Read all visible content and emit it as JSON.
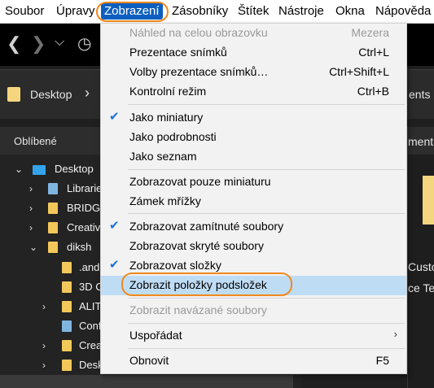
{
  "menubar": {
    "items": [
      "Soubor",
      "Úpravy",
      "Zobrazení",
      "Zásobníky",
      "Štítek",
      "Nástroje",
      "Okna",
      "Nápověda"
    ]
  },
  "address": {
    "path": "Desktop",
    "right_text": "ents"
  },
  "left_panel": {
    "title": "Oblíbené",
    "tree": [
      "Desktop",
      "Librarie",
      "BRIDGE",
      "Creative",
      "diksh",
      ".and",
      "3D C",
      "ALIT",
      "Conf",
      "Crea",
      "Desktop"
    ]
  },
  "right_panel": {
    "header": "ment",
    "line1": "Custo",
    "line2": "ce Te"
  },
  "menu": {
    "items": [
      {
        "label": "Náhled na celou obrazovku",
        "shortcut": "Mezera",
        "disabled": true
      },
      {
        "label": "Prezentace snímků",
        "shortcut": "Ctrl+L"
      },
      {
        "label": "Volby prezentace snímků…",
        "shortcut": "Ctrl+Shift+L"
      },
      {
        "label": "Kontrolní režim",
        "shortcut": "Ctrl+B"
      },
      {
        "label": "Jako miniatury",
        "checked": true
      },
      {
        "label": "Jako podrobnosti"
      },
      {
        "label": "Jako seznam"
      },
      {
        "label": "Zobrazovat pouze miniaturu"
      },
      {
        "label": "Zámek mřížky"
      },
      {
        "label": "Zobrazovat zamítnuté soubory",
        "checked": true
      },
      {
        "label": "Zobrazovat skryté soubory"
      },
      {
        "label": "Zobrazovat složky",
        "checked": true
      },
      {
        "label": "Zobrazit položky podsložek",
        "hover": true
      },
      {
        "label": "Zobrazit navázané soubory",
        "disabled": true
      },
      {
        "label": "Uspořádat",
        "submenu": true
      },
      {
        "label": "Obnovit",
        "shortcut": "F5"
      }
    ]
  },
  "colors": {
    "highlight_oval": "#f08a1c",
    "menubar_active": "#0d5fbf",
    "hover_row": "#bfdcf5",
    "check": "#1a72d9"
  }
}
